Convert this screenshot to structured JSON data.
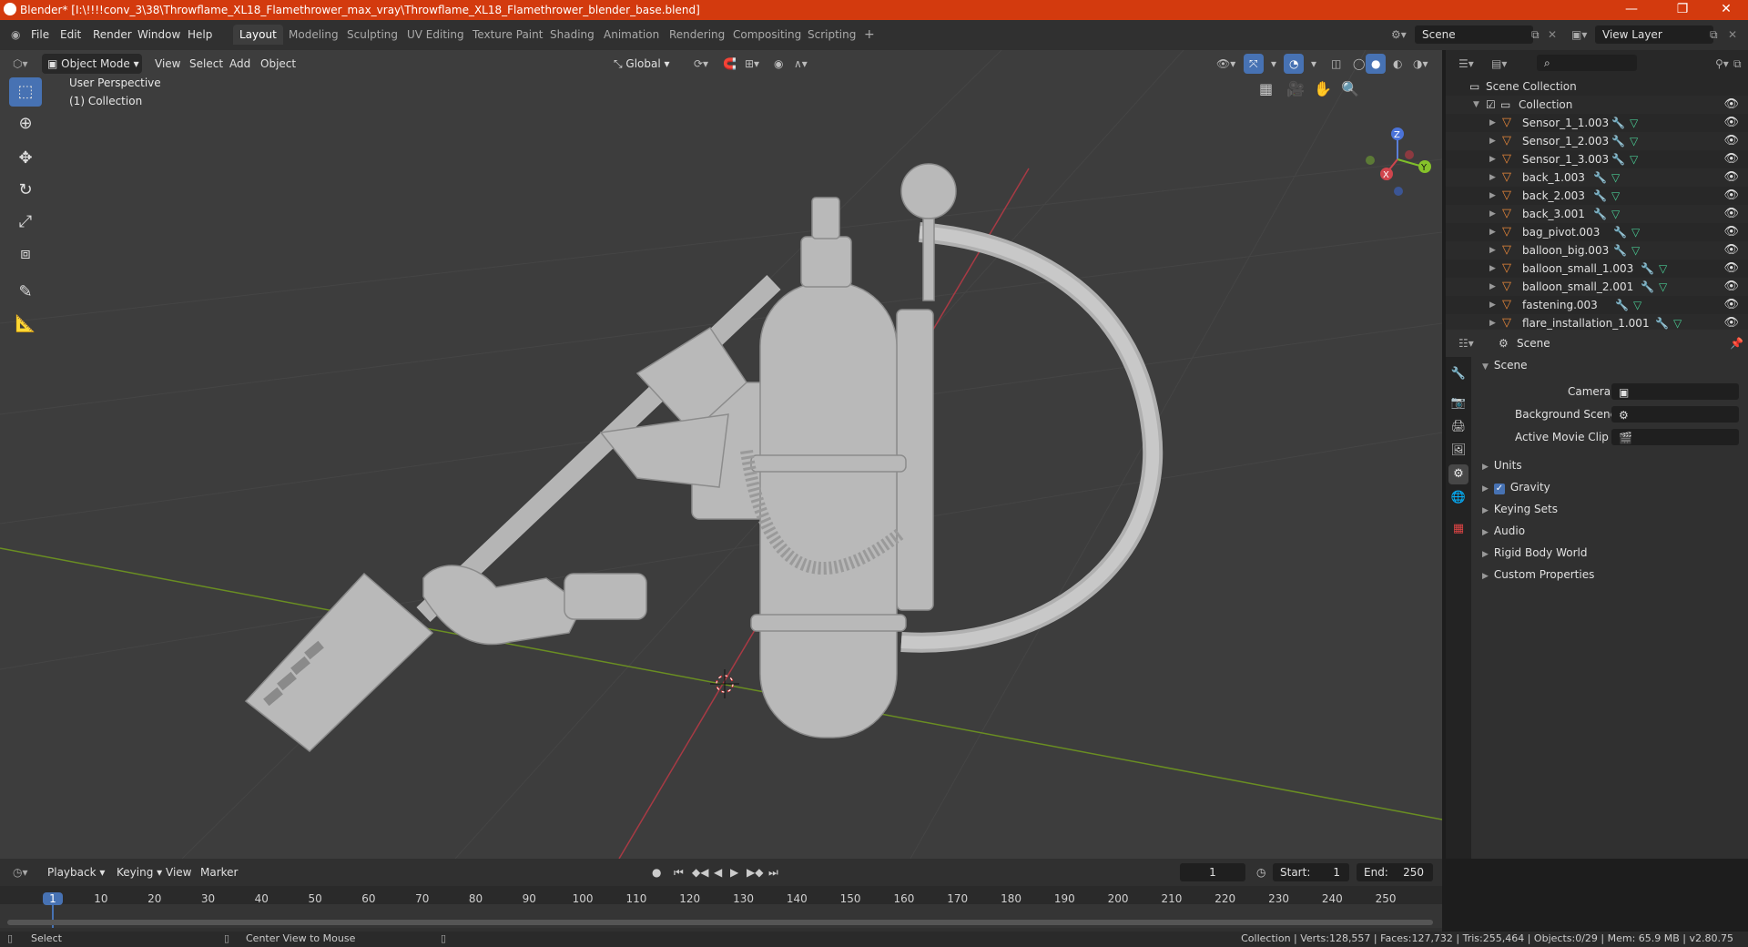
{
  "window": {
    "title": "Blender* [I:\\!!!!conv_3\\38\\Throwflame_XL18_Flamethrower_max_vray\\Throwflame_XL18_Flamethrower_blender_base.blend]",
    "minimize": "—",
    "maximize": "❐",
    "close": "✕"
  },
  "menu": [
    "File",
    "Edit",
    "Render",
    "Window",
    "Help"
  ],
  "workspaces": {
    "tabs": [
      "Layout",
      "Modeling",
      "Sculpting",
      "UV Editing",
      "Texture Paint",
      "Shading",
      "Animation",
      "Rendering",
      "Compositing",
      "Scripting"
    ],
    "add": "+"
  },
  "scene_selector": {
    "value": "Scene"
  },
  "view_layer_selector": {
    "value": "View Layer"
  },
  "viewport_header": {
    "mode": "Object Mode",
    "menus": [
      "View",
      "Select",
      "Add",
      "Object"
    ],
    "orientation": "Global"
  },
  "viewport": {
    "perspective_label": "User Perspective",
    "collection_label": "(1) Collection",
    "gizmo": {
      "x": "X",
      "y": "Y",
      "z": "Z"
    }
  },
  "outliner": {
    "root": "Scene Collection",
    "collection": "Collection",
    "objects": [
      "Sensor_1_1.003",
      "Sensor_1_2.003",
      "Sensor_1_3.003",
      "back_1.003",
      "back_2.003",
      "back_3.001",
      "bag_pivot.003",
      "balloon_big.003",
      "balloon_small_1.003",
      "balloon_small_2.001",
      "fastening.003",
      "flare_installation_1.001"
    ]
  },
  "properties": {
    "header": "Scene",
    "panel_title": "Scene",
    "camera_label": "Camera",
    "background_scene_label": "Background Scene",
    "active_movie_clip_label": "Active Movie Clip",
    "sections": [
      "Units",
      "Gravity",
      "Keying Sets",
      "Audio",
      "Rigid Body World",
      "Custom Properties"
    ]
  },
  "timeline": {
    "menus": [
      "Playback",
      "Keying",
      "View",
      "Marker"
    ],
    "current_frame": "1",
    "start_label": "Start:",
    "start_value": "1",
    "end_label": "End:",
    "end_value": "250",
    "ruler": [
      "1",
      "10",
      "20",
      "30",
      "40",
      "50",
      "60",
      "70",
      "80",
      "90",
      "100",
      "110",
      "120",
      "130",
      "140",
      "150",
      "160",
      "170",
      "180",
      "190",
      "200",
      "210",
      "220",
      "230",
      "240",
      "250"
    ]
  },
  "status": {
    "left": "Select",
    "middle": "Center View to Mouse",
    "right": "Collection | Verts:128,557 | Faces:127,732 | Tris:255,464 | Objects:0/29 | Mem: 65.9 MB | v2.80.75"
  }
}
